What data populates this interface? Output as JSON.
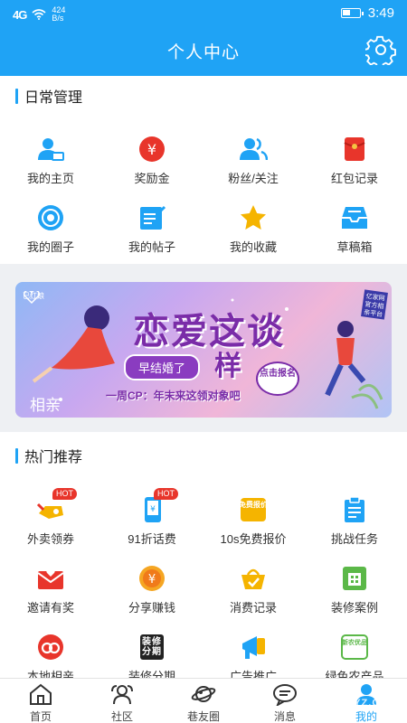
{
  "status_bar": {
    "signal": "4G",
    "net_speed": "424",
    "net_unit": "B/s",
    "time": "3:49"
  },
  "header": {
    "title": "个人中心"
  },
  "daily": {
    "title": "日常管理",
    "items": [
      {
        "label": "我的主页",
        "icon": "user-card-icon"
      },
      {
        "label": "奖励金",
        "icon": "yuan-coin-icon"
      },
      {
        "label": "粉丝/关注",
        "icon": "fans-icon"
      },
      {
        "label": "红包记录",
        "icon": "red-envelope-icon"
      },
      {
        "label": "我的圈子",
        "icon": "circle-target-icon"
      },
      {
        "label": "我的帖子",
        "icon": "post-edit-icon"
      },
      {
        "label": "我的收藏",
        "icon": "star-icon"
      },
      {
        "label": "草稿箱",
        "icon": "inbox-tray-icon"
      }
    ]
  },
  "banner": {
    "brand": "已红娘",
    "title": "恋爱这谈",
    "title2": "样",
    "pill": "早结婚了",
    "cta": "点击报名",
    "subtitle": "一周CP：年末来这领对象吧",
    "tag": "相亲",
    "corner": "亿家网官方相亲平台"
  },
  "hot": {
    "title": "热门推荐",
    "badge": "HOT",
    "items": [
      {
        "label": "外卖领券",
        "icon": "delivery-coupon-icon",
        "hot": true
      },
      {
        "label": "91折话费",
        "icon": "phone-bill-icon",
        "hot": true
      },
      {
        "label": "10s免费报价",
        "icon": "free-quote-icon",
        "icon_text": "免费报价"
      },
      {
        "label": "挑战任务",
        "icon": "clipboard-task-icon"
      },
      {
        "label": "邀请有奖",
        "icon": "invite-envelope-icon"
      },
      {
        "label": "分享赚钱",
        "icon": "share-money-icon"
      },
      {
        "label": "消费记录",
        "icon": "shopping-basket-icon"
      },
      {
        "label": "装修案例",
        "icon": "decor-case-icon"
      },
      {
        "label": "本地相亲",
        "icon": "heart-rings-icon"
      },
      {
        "label": "装修分期",
        "icon": "decor-installment-icon",
        "icon_text": "装修分期"
      },
      {
        "label": "广告推广",
        "icon": "ad-promo-icon"
      },
      {
        "label": "绿色农产品",
        "icon": "green-produce-icon",
        "icon_text": "新农优品"
      }
    ]
  },
  "tabbar": {
    "items": [
      {
        "label": "首页",
        "icon": "home-icon"
      },
      {
        "label": "社区",
        "icon": "community-icon"
      },
      {
        "label": "巷友圈",
        "icon": "planet-icon"
      },
      {
        "label": "消息",
        "icon": "message-icon"
      },
      {
        "label": "我的",
        "icon": "profile-icon",
        "active": true
      }
    ]
  },
  "watermark": "7YZ.COM",
  "colors": {
    "primary": "#1fa3f5",
    "red": "#e8352b",
    "gold": "#f5b400"
  }
}
